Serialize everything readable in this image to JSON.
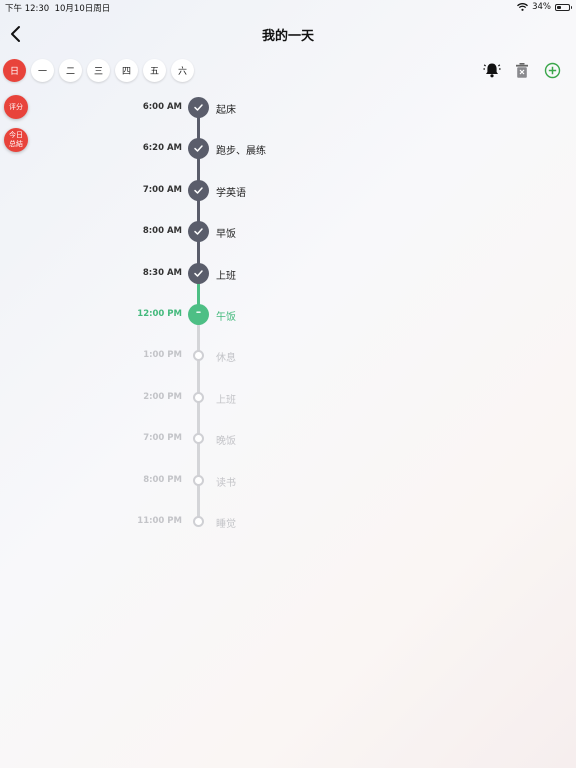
{
  "status": {
    "time": "下午 12:30",
    "date": "10月10日周日",
    "battery": "34%",
    "battery_level": 0.34
  },
  "nav": {
    "title": "我的一天"
  },
  "days": [
    "日",
    "一",
    "二",
    "三",
    "四",
    "五",
    "六"
  ],
  "active_day_index": 0,
  "toolbar": {
    "alarm_icon": "alarm-bell-icon",
    "delete_icon": "trash-icon",
    "add_icon": "add-circle-icon"
  },
  "side": {
    "rate": "评分",
    "summary_line1": "今日",
    "summary_line2": "总結"
  },
  "colors": {
    "accent_red": "#e8433b",
    "done": "#5a5d6b",
    "current": "#4dbf85",
    "pending": "#cfd0d4",
    "add_green": "#3aa64a"
  },
  "timeline": [
    {
      "time": "6:00 AM",
      "label": "起床",
      "status": "done"
    },
    {
      "time": "6:20 AM",
      "label": "跑步、晨练",
      "status": "done"
    },
    {
      "time": "7:00 AM",
      "label": "学英语",
      "status": "done"
    },
    {
      "time": "8:00 AM",
      "label": "早饭",
      "status": "done"
    },
    {
      "time": "8:30 AM",
      "label": "上班",
      "status": "done"
    },
    {
      "time": "12:00 PM",
      "label": "午饭",
      "status": "current"
    },
    {
      "time": "1:00 PM",
      "label": "休息",
      "status": "pending"
    },
    {
      "time": "2:00 PM",
      "label": "上班",
      "status": "pending"
    },
    {
      "time": "7:00 PM",
      "label": "晚饭",
      "status": "pending"
    },
    {
      "time": "8:00 PM",
      "label": "读书",
      "status": "pending"
    },
    {
      "time": "11:00 PM",
      "label": "睡觉",
      "status": "pending"
    }
  ]
}
